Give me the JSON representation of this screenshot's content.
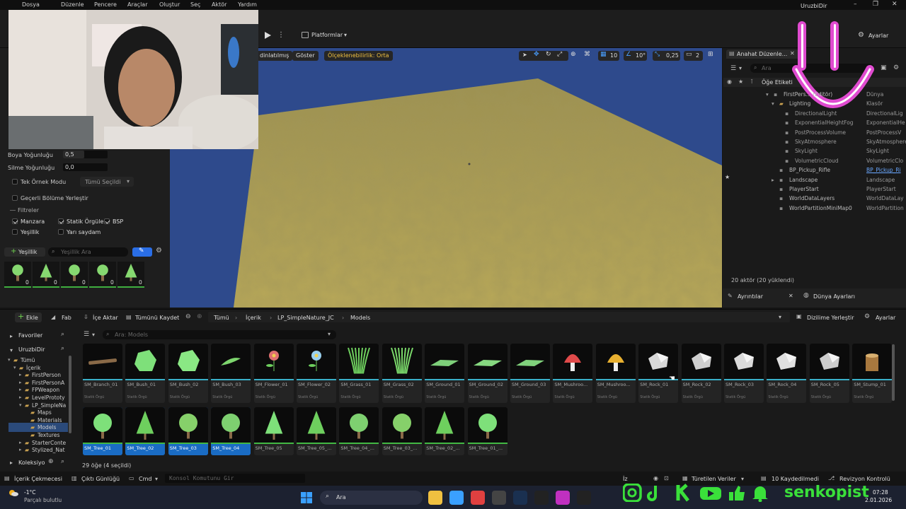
{
  "menu": [
    "Dosya",
    "Düzenle",
    "Pencere",
    "Araçlar",
    "Oluştur",
    "Seç",
    "Aktör",
    "Yardım"
  ],
  "project_name": "UruzbiDir",
  "toolbar": {
    "platforms": "Platformlar",
    "settings": "Ayarlar"
  },
  "viewport": {
    "lit": "dinlatılmış",
    "show": "Göster",
    "scalability": "Ölçeklenebilirlik: Orta",
    "grid_snap": "10",
    "rot_snap": "10°",
    "scale_snap": "0,25",
    "cam": "2"
  },
  "foliage": {
    "paint_density_label": "Boya Yoğunluğu",
    "paint_density": "0,5",
    "erase_density_label": "Silme Yoğunluğu",
    "erase_density": "0,0",
    "single_instance_label": "Tek Örnek Modu",
    "single_instance_value": "Tümü Seçildi",
    "place_in_level": "Geçerli Bölüme Yerleştir",
    "filters_label": "Filtreler",
    "filters": [
      {
        "label": "Manzara",
        "on": true
      },
      {
        "label": "Statik Örgüler",
        "on": true
      },
      {
        "label": "BSP",
        "on": true
      },
      {
        "label": "Yeşillik",
        "on": false
      },
      {
        "label": "Yarı saydam",
        "on": false
      }
    ],
    "add_label": "Yeşillik",
    "search_placeholder": "Yeşillik Ara",
    "counts": [
      "0",
      "0",
      "0",
      "0",
      "0"
    ]
  },
  "outliner": {
    "tab": "Anahat Düzenle...",
    "search_placeholder": "Ara",
    "col_label": "Öğe Etiketi",
    "rows": [
      {
        "name": "FirstPers... (Editör)",
        "type": "Dünya",
        "indent": 0,
        "link": false
      },
      {
        "name": "Lighting",
        "type": "Klasör",
        "indent": 1,
        "link": false
      },
      {
        "name": "DirectionalLight",
        "type": "DirectionalLig",
        "indent": 2,
        "link": false
      },
      {
        "name": "ExponentialHeightFog",
        "type": "ExponentialHe",
        "indent": 2,
        "link": false
      },
      {
        "name": "PostProcessVolume",
        "type": "PostProcessV",
        "indent": 2,
        "link": false
      },
      {
        "name": "SkyAtmosphere",
        "type": "SkyAtmosphere",
        "indent": 2,
        "link": false
      },
      {
        "name": "SkyLight",
        "type": "SkyLight",
        "indent": 2,
        "link": false
      },
      {
        "name": "VolumetricCloud",
        "type": "VolumetricClo",
        "indent": 2,
        "link": false
      },
      {
        "name": "BP_Pickup_Rifle",
        "type": "BP_Pickup_Ri",
        "indent": 1,
        "link": true
      },
      {
        "name": "Landscape",
        "type": "Landscape",
        "indent": 1,
        "link": false
      },
      {
        "name": "PlayerStart",
        "type": "PlayerStart",
        "indent": 1,
        "link": false
      },
      {
        "name": "WorldDataLayers",
        "type": "WorldDataLay",
        "indent": 1,
        "link": false
      },
      {
        "name": "WorldPartitionMiniMap0",
        "type": "WorldPartition",
        "indent": 1,
        "link": false
      }
    ],
    "actor_count": "20 aktör (20 yüklendi)"
  },
  "details_tabs": [
    "Ayrıntılar",
    "Dünya Ayarları"
  ],
  "content_browser": {
    "add": "Ekle",
    "fab": "Fab",
    "import": "İçe Aktar",
    "save_all": "Tümünü Kaydet",
    "breadcrumb": [
      "Tümü",
      "İçerik",
      "LP_SimpleNature_JC",
      "Models"
    ],
    "dock": "Dizilime Yerleştir",
    "settings": "Ayarlar",
    "favorites": "Favoriler",
    "project": "UruzbiDir",
    "tree": [
      "Tümü",
      "İçerik",
      "FirstPerson",
      "FirstPersonA",
      "FPWeapon",
      "LevelPrototy",
      "LP_SimpleNa",
      "Maps",
      "Materials",
      "Models",
      "Textures",
      "StarterConte",
      "Stylized_Nat"
    ],
    "collections": "Koleksiyo",
    "search_placeholder": "Ara: Models",
    "assets": [
      {
        "name": "SM_Branch_01",
        "type": "Statik Örgü",
        "shape": "branch",
        "color": "#8a6a48"
      },
      {
        "name": "SM_Bush_01",
        "type": "Statik Örgü",
        "shape": "bush",
        "color": "#7ee07a"
      },
      {
        "name": "SM_Bush_02",
        "type": "Statik Örgü",
        "shape": "bush",
        "color": "#8ae884"
      },
      {
        "name": "SM_Bush_03",
        "type": "Statik Örgü",
        "shape": "leaf",
        "color": "#7ed66e"
      },
      {
        "name": "SM_Flower_01",
        "type": "Statik Örgü",
        "shape": "flower",
        "color": "#e07070"
      },
      {
        "name": "SM_Flower_02",
        "type": "Statik Örgü",
        "shape": "flower",
        "color": "#9ad0ee"
      },
      {
        "name": "SM_Grass_01",
        "type": "Statik Örgü",
        "shape": "grass",
        "color": "#6ecf5e"
      },
      {
        "name": "SM_Grass_02",
        "type": "Statik Örgü",
        "shape": "grass",
        "color": "#7ad86a"
      },
      {
        "name": "SM_Ground_01",
        "type": "Statik Örgü",
        "shape": "ground",
        "color": "#7ed07a"
      },
      {
        "name": "SM_Ground_02",
        "type": "Statik Örgü",
        "shape": "ground",
        "color": "#86d880"
      },
      {
        "name": "SM_Ground_03",
        "type": "Statik Örgü",
        "shape": "ground",
        "color": "#80d27c"
      },
      {
        "name": "SM_Mushroo...",
        "type": "Statik Örgü",
        "shape": "mushroom",
        "color": "#e04a4a"
      },
      {
        "name": "SM_Mushroo...",
        "type": "Statik Örgü",
        "shape": "mushroom",
        "color": "#e8b030"
      },
      {
        "name": "SM_Rock_01",
        "type": "Statik Örgü",
        "shape": "rock",
        "color": "#d8d8d8"
      },
      {
        "name": "SM_Rock_02",
        "type": "Statik Örgü",
        "shape": "rock",
        "color": "#cfcfcf"
      },
      {
        "name": "SM_Rock_03",
        "type": "Statik Örgü",
        "shape": "rock",
        "color": "#dadada"
      },
      {
        "name": "SM_Rock_04",
        "type": "Statik Örgü",
        "shape": "rock",
        "color": "#e0e0e0"
      },
      {
        "name": "SM_Rock_05",
        "type": "Statik Örgü",
        "shape": "rock",
        "color": "#cccccc"
      },
      {
        "name": "SM_Stump_01",
        "type": "Statik Örgü",
        "shape": "stump",
        "color": "#a8783e"
      },
      {
        "name": "SM_Tree_01",
        "type": "",
        "shape": "tree",
        "color": "#7ee07a",
        "selected": true
      },
      {
        "name": "SM_Tree_02",
        "type": "",
        "shape": "pine",
        "color": "#6ecf5e",
        "selected": true
      },
      {
        "name": "SM_Tree_03",
        "type": "",
        "shape": "tree",
        "color": "#86d06a",
        "selected": true
      },
      {
        "name": "SM_Tree_04",
        "type": "",
        "shape": "tree",
        "color": "#7ed070",
        "selected": true
      },
      {
        "name": "SM_Tree_05",
        "type": "",
        "shape": "pine",
        "color": "#7ee07a"
      },
      {
        "name": "SM_Tree_05_...",
        "type": "",
        "shape": "pine",
        "color": "#6ecf5e"
      },
      {
        "name": "SM_Tree_04_...",
        "type": "",
        "shape": "tree",
        "color": "#7ed070"
      },
      {
        "name": "SM_Tree_03_...",
        "type": "",
        "shape": "tree",
        "color": "#86d06a"
      },
      {
        "name": "SM_Tree_02_...",
        "type": "",
        "shape": "pine",
        "color": "#6ecf5e"
      },
      {
        "name": "SM_Tree_01_...",
        "type": "",
        "shape": "tree",
        "color": "#7ee07a"
      }
    ],
    "item_count": "29 öğe (4 seçildi)"
  },
  "statusbar": {
    "content_drawer": "İçerik Çekmecesi",
    "output_log": "Çıktı Günlüğü",
    "cmd": "Cmd",
    "console_placeholder": "Konsol Komutunu Gir",
    "iz": "İz",
    "derived": "Türetilen Veriler",
    "saved": "10 Kaydedilmedi",
    "revision": "Revizyon Kontrolü"
  },
  "taskbar": {
    "temp": "-1°C",
    "weather": "Parçalı bulutlu",
    "search": "Ara",
    "time": "07:28",
    "date": "2.01.2026"
  },
  "overlay": {
    "channel": "senkopist"
  }
}
